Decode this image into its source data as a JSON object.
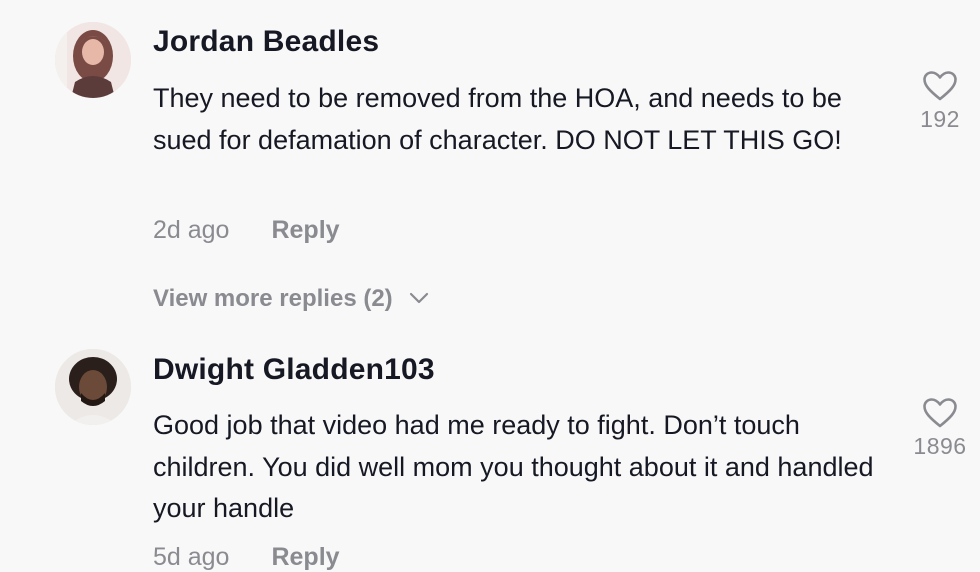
{
  "comments": [
    {
      "username": "Jordan Beadles",
      "text": "They need to be removed from the HOA, and needs to be sued for defamation of character. DO NOT LET THIS GO!",
      "time": "2d ago",
      "reply_label": "Reply",
      "likes": "192",
      "view_more_replies": "View more replies (2)",
      "avatar_icon": "user-avatar-photo"
    },
    {
      "username": "Dwight Gladden103",
      "text": "Good job that video had me ready to fight. Don’t touch children. You did well mom you thought about it and handled your handle",
      "time": "5d ago",
      "reply_label": "Reply",
      "likes": "1896",
      "avatar_icon": "user-avatar-photo"
    }
  ],
  "icons": {
    "like": "heart-outline-icon",
    "expand": "chevron-down-icon"
  },
  "colors": {
    "background": "#f8f8f8",
    "primary_text": "#161823",
    "secondary_text": "#8a8b91"
  }
}
